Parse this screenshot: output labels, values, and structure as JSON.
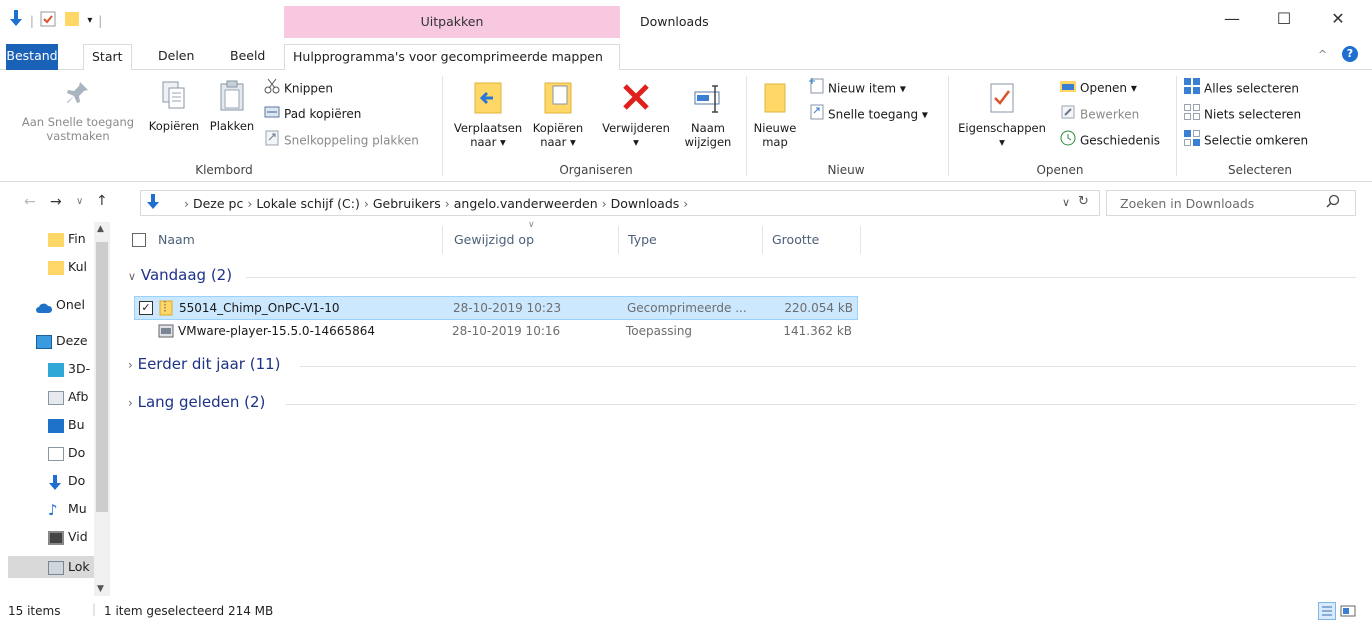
{
  "window": {
    "title": "Downloads",
    "context_tab_header": "Uitpakken",
    "controls": {
      "minimize": "—",
      "maximize": "☐",
      "close": "✕"
    }
  },
  "ribbon_tabs": {
    "bestand": "Bestand",
    "start": "Start",
    "delen": "Delen",
    "beeld": "Beeld",
    "hulp": "Hulpprogramma's voor gecomprimeerde mappen"
  },
  "ribbon": {
    "klembord": {
      "label": "Klembord",
      "pin": "Aan Snelle toegang vastmaken",
      "kopieren": "Kopiëren",
      "plakken": "Plakken",
      "knippen": "Knippen",
      "pad_kopieren": "Pad kopiëren",
      "snelkoppeling_plakken": "Snelkoppeling plakken"
    },
    "organiseren": {
      "label": "Organiseren",
      "verplaatsen": "Verplaatsen naar ▾",
      "kopieren_naar": "Kopiëren naar ▾",
      "verwijderen": "Verwijderen",
      "naam_wijzigen": "Naam wijzigen"
    },
    "nieuw": {
      "label": "Nieuw",
      "nieuwe_map": "Nieuwe map",
      "nieuw_item": "Nieuw item ▾",
      "snelle_toegang": "Snelle toegang ▾"
    },
    "openen": {
      "label": "Openen",
      "eigenschappen": "Eigenschappen",
      "openen": "Openen ▾",
      "bewerken": "Bewerken",
      "geschiedenis": "Geschiedenis"
    },
    "selecteren": {
      "label": "Selecteren",
      "alles": "Alles selecteren",
      "niets": "Niets selecteren",
      "omkeren": "Selectie omkeren"
    }
  },
  "address": {
    "crumbs": [
      "Deze pc",
      "Lokale schijf (C:)",
      "Gebruikers",
      "angelo.vanderweerden",
      "Downloads"
    ],
    "search_placeholder": "Zoeken in Downloads"
  },
  "nav": {
    "items": [
      "Fin",
      "Kul",
      "Onel",
      "Deze",
      "3D-",
      "Afb",
      "Bu",
      "Do",
      "Do",
      "Mu",
      "Vid",
      "Lok"
    ]
  },
  "columns": {
    "name": "Naam",
    "modified": "Gewijzigd op",
    "type": "Type",
    "size": "Grootte"
  },
  "groups": {
    "today": "Vandaag (2)",
    "this_year": "Eerder dit jaar (11)",
    "long_ago": "Lang geleden (2)"
  },
  "files": [
    {
      "name": "55014_Chimp_OnPC-V1-10",
      "modified": "28-10-2019 10:23",
      "type": "Gecomprimeerde ...",
      "size": "220.054 kB"
    },
    {
      "name": "VMware-player-15.5.0-14665864",
      "modified": "28-10-2019 10:16",
      "type": "Toepassing",
      "size": "141.362 kB"
    }
  ],
  "status": {
    "count": "15 items",
    "selection": "1 item geselecteerd  214 MB"
  },
  "colors": {
    "accent": "#1a62b8",
    "context_tab": "#f7c8e0",
    "selection": "#cce8ff",
    "group_text": "#1e3287"
  }
}
